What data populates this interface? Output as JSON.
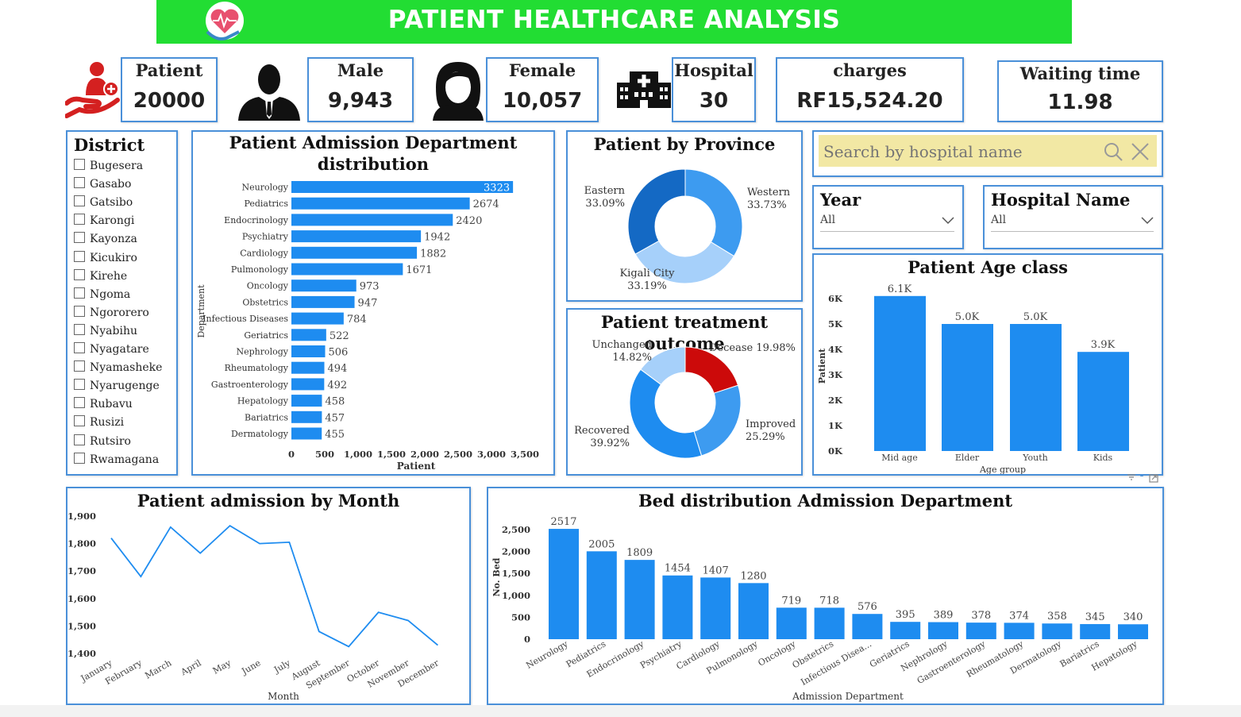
{
  "header": {
    "title": "PATIENT HEALTHCARE ANALYSIS"
  },
  "kpis": {
    "patient": {
      "label": "Patient",
      "value": "20000"
    },
    "male": {
      "label": "Male",
      "value": "9,943"
    },
    "female": {
      "label": "Female",
      "value": "10,057"
    },
    "hospital": {
      "label": "Hospital",
      "value": "30"
    },
    "charges": {
      "label": "charges",
      "value": "RF15,524.20"
    },
    "waiting": {
      "label": "Waiting time",
      "value": "11.98"
    }
  },
  "district": {
    "title": "District",
    "items": [
      "Bugesera",
      "Gasabo",
      "Gatsibo",
      "Karongi",
      "Kayonza",
      "Kicukiro",
      "Kirehe",
      "Ngoma",
      "Ngororero",
      "Nyabihu",
      "Nyagatare",
      "Nyamasheke",
      "Nyarugenge",
      "Rubavu",
      "Rusizi",
      "Rutsiro",
      "Rwamagana"
    ]
  },
  "search": {
    "placeholder": "Search by hospital name"
  },
  "filters": {
    "year": {
      "label": "Year",
      "value": "All"
    },
    "hospital": {
      "label": "Hospital Name",
      "value": "All"
    }
  },
  "colors": {
    "bar": "#1e8cf0",
    "banner": "#22dd33",
    "donut_dark": "#1469c4",
    "donut_mid": "#3d9bf0",
    "donut_light": "#a6d0fa",
    "decease": "#cc0a0a"
  },
  "admission_dept": {
    "title": "Patient Admission Department distribution",
    "chart_data": {
      "type": "bar",
      "orientation": "horizontal",
      "categories": [
        "Neurology",
        "Pediatrics",
        "Endocrinology",
        "Psychiatry",
        "Cardiology",
        "Pulmonology",
        "Oncology",
        "Obstetrics",
        "Infectious Diseases",
        "Geriatrics",
        "Nephrology",
        "Rheumatology",
        "Gastroenterology",
        "Hepatology",
        "Bariatrics",
        "Dermatology"
      ],
      "values": [
        3323,
        2674,
        2420,
        1942,
        1882,
        1671,
        973,
        947,
        784,
        522,
        506,
        494,
        492,
        458,
        457,
        455
      ],
      "xlabel": "Patient",
      "ylabel": "Department",
      "xticks": [
        "0",
        "500",
        "1,000",
        "1,500",
        "2,000",
        "2,500",
        "3,000",
        "3,500"
      ],
      "xlim": [
        0,
        3500
      ]
    }
  },
  "province": {
    "title": "Patient by Province",
    "chart_data": {
      "type": "pie",
      "labels": [
        "Western",
        "Kigali City",
        "Eastern"
      ],
      "values": [
        33.73,
        33.19,
        33.09
      ],
      "display": [
        "33.73%",
        "33.19%",
        "33.09%"
      ]
    }
  },
  "outcome": {
    "title": "Patient treatment outcome",
    "chart_data": {
      "type": "pie",
      "labels": [
        "Decease",
        "Improved",
        "Recovered",
        "Unchanged"
      ],
      "values": [
        19.98,
        25.29,
        39.92,
        14.82
      ],
      "display": [
        "19.98%",
        "25.29%",
        "39.92%",
        "14.82%"
      ]
    }
  },
  "age_class": {
    "title": "Patient Age class",
    "chart_data": {
      "type": "bar",
      "categories": [
        "Mid age",
        "Elder",
        "Youth",
        "Kids"
      ],
      "values": [
        6100,
        5000,
        5000,
        3900
      ],
      "labels": [
        "6.1K",
        "5.0K",
        "5.0K",
        "3.9K"
      ],
      "xlabel": "Age group",
      "ylabel": "Patient",
      "yticks": [
        "0K",
        "1K",
        "2K",
        "3K",
        "4K",
        "5K",
        "6K"
      ],
      "ylim": [
        0,
        6000
      ]
    }
  },
  "monthly": {
    "title": "Patient admission by Month",
    "chart_data": {
      "type": "line",
      "x": [
        "January",
        "February",
        "March",
        "April",
        "May",
        "June",
        "July",
        "August",
        "September",
        "October",
        "November",
        "December"
      ],
      "y": [
        1820,
        1680,
        1860,
        1765,
        1865,
        1800,
        1805,
        1480,
        1425,
        1550,
        1520,
        1430
      ],
      "xlabel": "Month",
      "yticks": [
        "1,400",
        "1,500",
        "1,600",
        "1,700",
        "1,800",
        "1,900"
      ],
      "ylim": [
        1400,
        1900
      ]
    }
  },
  "beds": {
    "title": "Bed distribution Admission Department",
    "chart_data": {
      "type": "bar",
      "categories": [
        "Neurology",
        "Pediatrics",
        "Endocrinology",
        "Psychiatry",
        "Cardiology",
        "Pulmonology",
        "Oncology",
        "Obstetrics",
        "Infectious Disea...",
        "Geriatrics",
        "Nephrology",
        "Gastroenterology",
        "Rheumatology",
        "Dermatology",
        "Bariatrics",
        "Hepatology"
      ],
      "values": [
        2517,
        2005,
        1809,
        1454,
        1407,
        1280,
        719,
        718,
        576,
        395,
        389,
        378,
        374,
        358,
        345,
        340
      ],
      "xlabel": "Admission Department",
      "ylabel": "No. Bed",
      "yticks": [
        "0",
        "500",
        "1,000",
        "1,500",
        "2,000",
        "2,500"
      ],
      "ylim": [
        0,
        2500
      ]
    }
  }
}
